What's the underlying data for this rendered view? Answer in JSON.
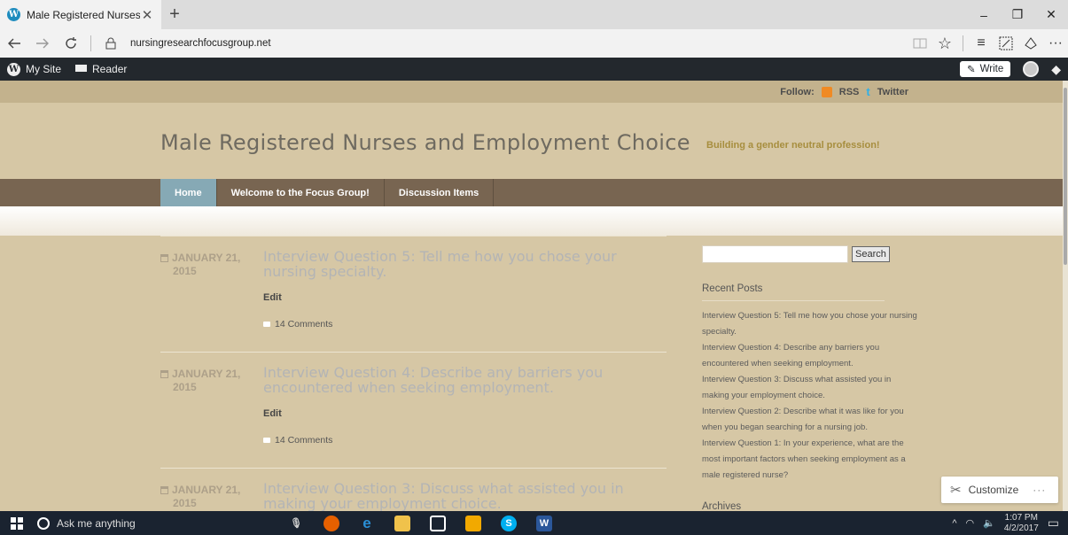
{
  "browser": {
    "tab_title": "Male Registered Nurses",
    "tab_close": "✕",
    "new_tab": "+",
    "url": "nursingresearchfocusgroup.net",
    "window_controls": [
      "–",
      "❐",
      "✕"
    ],
    "toolbar_more": "···"
  },
  "adminbar": {
    "my_site": "My Site",
    "reader": "Reader",
    "write": "Write"
  },
  "site": {
    "follow_label": "Follow:",
    "rss": "RSS",
    "twitter": "Twitter",
    "title": "Male Registered Nurses and Employment Choice",
    "tagline": "Building a gender neutral profession!",
    "menu": [
      "Home",
      "Welcome to the Focus Group!",
      "Discussion Items"
    ]
  },
  "posts": [
    {
      "date1": "JANUARY 21,",
      "date2": "2015",
      "title": "Interview Question 5: Tell me how you chose your nursing specialty.",
      "edit": "Edit",
      "comments": "14 Comments"
    },
    {
      "date1": "JANUARY 21,",
      "date2": "2015",
      "title": "Interview Question 4: Describe any barriers you encountered when seeking employment.",
      "edit": "Edit",
      "comments": "14 Comments"
    },
    {
      "date1": "JANUARY 21,",
      "date2": "2015",
      "title": "Interview Question 3: Discuss what assisted you in making your employment choice."
    }
  ],
  "sidebar": {
    "search_button": "Search",
    "recent_posts_heading": "Recent Posts",
    "recent_posts": [
      "Interview Question 5: Tell me how you chose your nursing specialty.",
      "Interview Question 4: Describe any barriers you encountered when seeking employment.",
      "Interview Question 3: Discuss what assisted you in making your employment choice.",
      "Interview Question 2: Describe what it was like for you when you began searching for a nursing job.",
      "Interview Question 1: In your experience, what are the most important factors when seeking employment as a male registered nurse?"
    ],
    "archives_heading": "Archives",
    "customize": "Customize",
    "customize_more": "···"
  },
  "taskbar": {
    "search_placeholder": "Ask me anything",
    "time": "1:07 PM",
    "date": "4/2/2017"
  },
  "colors": {
    "admin_bar": "#23282d",
    "nav_bar": "#786551",
    "active_menu": "#86a9b5",
    "page_bg": "#d6c7a5"
  }
}
